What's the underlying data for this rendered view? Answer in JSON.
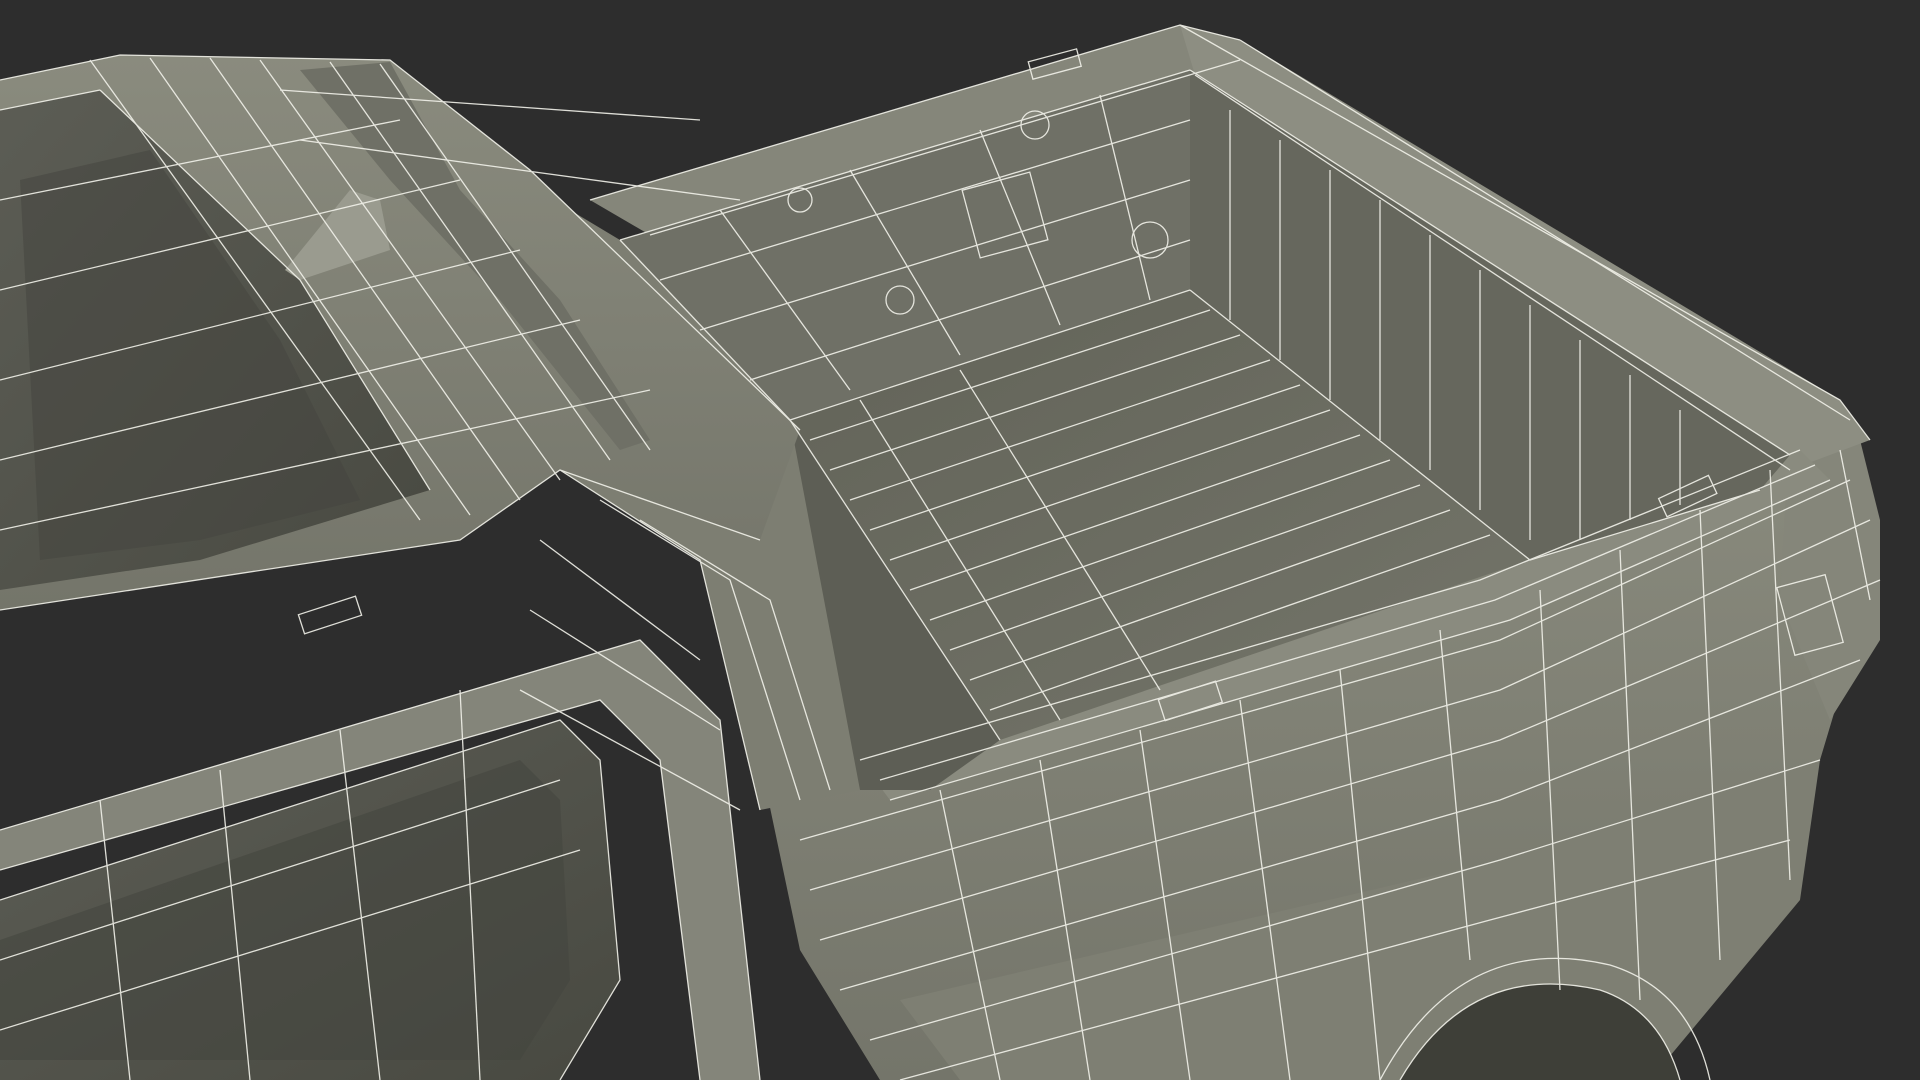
{
  "scene": {
    "subject": "pickup-truck-wireframe-render",
    "colors": {
      "background": "#2d2d2d",
      "body_surface": "#7b7c6f",
      "body_light": "#8c8d80",
      "body_dark": "#5f6057",
      "bed_floor": "#6c6d62",
      "glass": "#56574f",
      "glass_dark": "#45463f",
      "wire": "#f2f2ea",
      "shadow": "#4a4b43"
    }
  }
}
